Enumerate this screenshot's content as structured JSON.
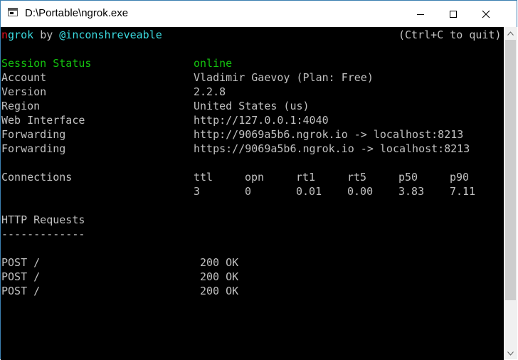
{
  "window": {
    "title": "D:\\Portable\\ngrok.exe",
    "controls": {
      "minimize_icon": "minimize-icon",
      "maximize_icon": "maximize-icon",
      "close_icon": "close-icon"
    }
  },
  "header": {
    "brand_first": "n",
    "brand_rest": "grok",
    "by": "by",
    "author": "@inconshreveable",
    "quit_hint": "(Ctrl+C to quit)"
  },
  "status": [
    {
      "label": "Session Status",
      "value": "online"
    },
    {
      "label": "Account",
      "value": "Vladimir Gaevoy (Plan: Free)"
    },
    {
      "label": "Version",
      "value": "2.2.8"
    },
    {
      "label": "Region",
      "value": "United States (us)"
    },
    {
      "label": "Web Interface",
      "value": "http://127.0.0.1:4040"
    },
    {
      "label": "Forwarding",
      "value": "http://9069a5b6.ngrok.io -> localhost:8213"
    },
    {
      "label": "Forwarding",
      "value": "https://9069a5b6.ngrok.io -> localhost:8213"
    }
  ],
  "connections": {
    "label": "Connections",
    "headers": [
      "ttl",
      "opn",
      "rt1",
      "rt5",
      "p50",
      "p90"
    ],
    "values": [
      "3",
      "0",
      "0.01",
      "0.00",
      "3.83",
      "7.11"
    ]
  },
  "http_requests": {
    "title": "HTTP Requests",
    "separator": "-------------",
    "requests": [
      {
        "method_path": "POST /",
        "status": "200 OK"
      },
      {
        "method_path": "POST /",
        "status": "200 OK"
      },
      {
        "method_path": "POST /",
        "status": "200 OK"
      }
    ]
  },
  "colors": {
    "terminal_bg": "#000000",
    "text": "#c0c0c0",
    "online_green": "#14c30f",
    "author_cyan": "#3bdbe0",
    "brand_red": "#e81123"
  }
}
